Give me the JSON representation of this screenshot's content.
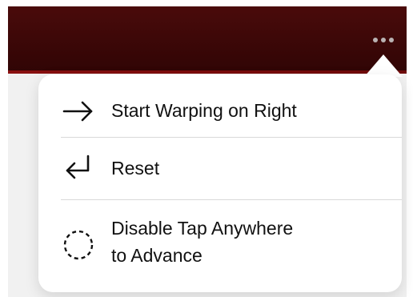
{
  "header": {
    "more_button_icon": "ellipsis-icon"
  },
  "menu": {
    "items": [
      {
        "label": "Start Warping on Right",
        "icon": "arrow-right-icon"
      },
      {
        "label": "Reset",
        "icon": "return-arrow-icon"
      },
      {
        "label": "Disable Tap Anywhere\nto Advance",
        "icon": "dashed-circle-icon"
      }
    ]
  },
  "colors": {
    "header": "#3a0707",
    "accent_line": "#8a1010",
    "popover": "#ffffff",
    "text": "#111111",
    "divider": "#d9d9d9",
    "page_bg": "#f1f1f1"
  }
}
